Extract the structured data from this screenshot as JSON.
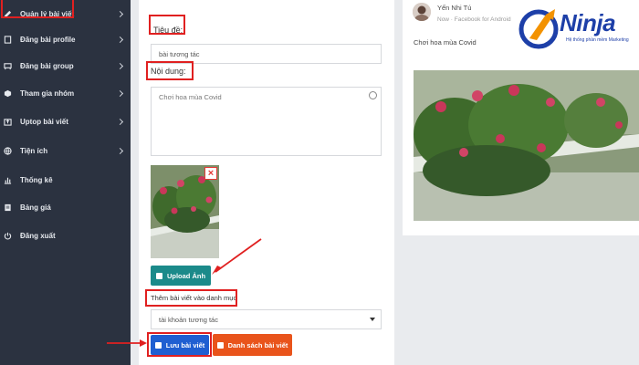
{
  "sidebar": {
    "items": [
      {
        "label": "Quản lý bài viết",
        "icon": "edit-icon",
        "chevron": true
      },
      {
        "label": "Đăng bài profile",
        "icon": "page-icon",
        "chevron": true
      },
      {
        "label": "Đăng bài group",
        "icon": "group-icon",
        "chevron": true
      },
      {
        "label": "Tham gia nhóm",
        "icon": "cube-icon",
        "chevron": true
      },
      {
        "label": "Uptop bài viết",
        "icon": "upload-icon",
        "chevron": true
      },
      {
        "label": "Tiện ích",
        "icon": "globe-icon",
        "chevron": true
      },
      {
        "label": "Thống kê",
        "icon": "bar-chart-icon",
        "chevron": false
      },
      {
        "label": "Bảng giá",
        "icon": "price-icon",
        "chevron": false
      },
      {
        "label": "Đăng xuất",
        "icon": "power-icon",
        "chevron": false
      }
    ]
  },
  "form": {
    "title_label": "Tiêu đề:",
    "title_value": "bài tương tác",
    "content_label": "Nội dung:",
    "content_value": "Chơi hoa mùa Covid",
    "upload_button": "Upload Ảnh",
    "delete_symbol": "×",
    "category_label": "Thêm bài viết vào danh mục",
    "category_selected": "tài khoản tương tác",
    "save_button": "Lưu bài viết",
    "list_button": "Danh sách bài viết"
  },
  "preview": {
    "author": "Yến Nhi Tú",
    "source": "Now · Facebook for Android",
    "text": "Chơi hoa mùa Covid"
  },
  "logo": {
    "name": "Ninja",
    "tagline": "Hệ thống phần mềm Marketing"
  },
  "colors": {
    "sidebar_bg": "#2b3240",
    "highlight_red": "#e02020",
    "upload_teal": "#1b8a8a",
    "save_blue": "#1f5fd1",
    "list_orange": "#e9541b",
    "brand_blue": "#1d3fa8",
    "brand_orange": "#f39200"
  }
}
